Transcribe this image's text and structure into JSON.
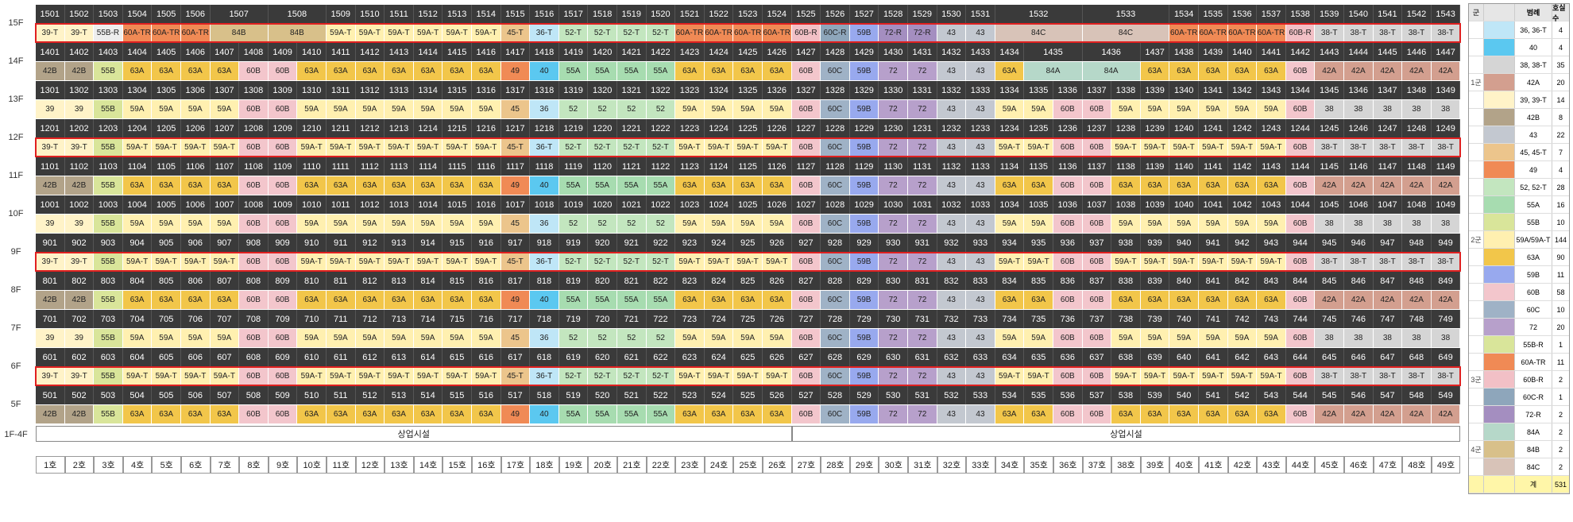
{
  "floors": [
    "15F",
    "14F",
    "13F",
    "12F",
    "11F",
    "10F",
    "9F",
    "8F",
    "7F",
    "6F",
    "5F",
    "1F-4F"
  ],
  "commercial_label": "상업시설",
  "col_labels": [
    "1호",
    "2호",
    "3호",
    "4호",
    "5호",
    "6호",
    "7호",
    "8호",
    "9호",
    "10호",
    "11호",
    "12호",
    "13호",
    "14호",
    "15호",
    "16호",
    "17호",
    "18호",
    "19호",
    "20호",
    "21호",
    "22호",
    "23호",
    "24호",
    "25호",
    "26호",
    "27호",
    "28호",
    "29호",
    "30호",
    "31호",
    "32호",
    "33호",
    "34호",
    "35호",
    "36호",
    "37호",
    "38호",
    "39호",
    "40호",
    "41호",
    "42호",
    "43호",
    "44호",
    "45호",
    "46호",
    "47호",
    "48호",
    "49호"
  ],
  "colors": {
    "39": "#fff3c8",
    "39-T": "#fff3c8",
    "42B": "#b2a389",
    "55B": "#d9e59a",
    "63A": "#f2c64a",
    "59A": "#fff0b0",
    "59A-T": "#fff0b0",
    "60B": "#f3c6cc",
    "45": "#ecc58c",
    "45-T": "#ecc58c",
    "49": "#f08a55",
    "40": "#5bc8f0",
    "36-T": "#bfe6f7",
    "36": "#bfe6f7",
    "52": "#c3e6bf",
    "52-T": "#c3e6bf",
    "55A": "#a7dcb0",
    "60C": "#9fb2c6",
    "59B": "#98a9ee",
    "72": "#b7a0cb",
    "43": "#c3c8d0",
    "38": "#d5d5d5",
    "38-T": "#d5d5d5",
    "42A": "#d39f8f",
    "60A-TR": "#f08a55",
    "84B": "#d8c08a",
    "84C": "#d8c3b8",
    "84A": "#b6d8c9",
    "60B-R": "#f2c0c6",
    "60C-R": "#8ea6bb",
    "72-R": "#a48ec0"
  },
  "rows": [
    {
      "floor": "15F",
      "nums": [
        [
          "1501",
          1
        ],
        [
          "1502",
          1
        ],
        [
          "1503",
          1
        ],
        [
          "1504",
          1
        ],
        [
          "1505",
          1
        ],
        [
          "1506",
          1
        ],
        [
          "1507",
          2
        ],
        [
          "1508",
          2
        ],
        [
          "1509",
          1
        ],
        [
          "1510",
          1
        ],
        [
          "1511",
          1
        ],
        [
          "1512",
          1
        ],
        [
          "1513",
          1
        ],
        [
          "1514",
          1
        ],
        [
          "1515",
          1
        ],
        [
          "1516",
          1
        ],
        [
          "1517",
          1
        ],
        [
          "1518",
          1
        ],
        [
          "1519",
          1
        ],
        [
          "1520",
          1
        ],
        [
          "1521",
          1
        ],
        [
          "1522",
          1
        ],
        [
          "1523",
          1
        ],
        [
          "1524",
          1
        ],
        [
          "1525",
          1
        ],
        [
          "1526",
          1
        ],
        [
          "1527",
          1
        ],
        [
          "1528",
          1
        ],
        [
          "1529",
          1
        ],
        [
          "1530",
          1
        ],
        [
          "1531",
          1
        ],
        [
          "1532",
          3
        ],
        [
          "1533",
          3
        ],
        [
          "1534",
          1
        ],
        [
          "1535",
          1
        ],
        [
          "1536",
          1
        ],
        [
          "1537",
          1
        ],
        [
          "1538",
          1
        ],
        [
          "1539",
          1
        ],
        [
          "1540",
          1
        ],
        [
          "1541",
          1
        ],
        [
          "1542",
          1
        ],
        [
          "1543",
          1
        ]
      ],
      "types": [
        [
          "39-T",
          1
        ],
        [
          "39-T",
          1
        ],
        [
          "55B-R",
          1
        ],
        [
          "60A-TR",
          1
        ],
        [
          "60A-TR",
          1
        ],
        [
          "60A-TR",
          1
        ],
        [
          "84B",
          2
        ],
        [
          "84B",
          2
        ],
        [
          "59A-T",
          1
        ],
        [
          "59A-T",
          1
        ],
        [
          "59A-T",
          1
        ],
        [
          "59A-T",
          1
        ],
        [
          "59A-T",
          1
        ],
        [
          "59A-T",
          1
        ],
        [
          "45-T",
          1
        ],
        [
          "36-T",
          1
        ],
        [
          "52-T",
          1
        ],
        [
          "52-T",
          1
        ],
        [
          "52-T",
          1
        ],
        [
          "52-T",
          1
        ],
        [
          "60A-TR",
          1
        ],
        [
          "60A-TR",
          1
        ],
        [
          "60A-TR",
          1
        ],
        [
          "60A-TR",
          1
        ],
        [
          "60B-R",
          1
        ],
        [
          "60C-R",
          1
        ],
        [
          "59B",
          1
        ],
        [
          "72-R",
          1
        ],
        [
          "72-R",
          1
        ],
        [
          "43",
          1
        ],
        [
          "43",
          1
        ],
        [
          "84C",
          3
        ],
        [
          "84C",
          3
        ],
        [
          "60A-TR",
          1
        ],
        [
          "60A-TR",
          1
        ],
        [
          "60A-TR",
          1
        ],
        [
          "60A-TR",
          1
        ],
        [
          "60B-R",
          1
        ],
        [
          "38-T",
          1
        ],
        [
          "38-T",
          1
        ],
        [
          "38-T",
          1
        ],
        [
          "38-T",
          1
        ],
        [
          "38-T",
          1
        ]
      ],
      "hl": true
    },
    {
      "floor": "14F",
      "nums": [
        [
          "1401",
          1
        ],
        [
          "1402",
          1
        ],
        [
          "1403",
          1
        ],
        [
          "1404",
          1
        ],
        [
          "1405",
          1
        ],
        [
          "1406",
          1
        ],
        [
          "1407",
          1
        ],
        [
          "1408",
          1
        ],
        [
          "1409",
          1
        ],
        [
          "1410",
          1
        ],
        [
          "1411",
          1
        ],
        [
          "1412",
          1
        ],
        [
          "1413",
          1
        ],
        [
          "1414",
          1
        ],
        [
          "1415",
          1
        ],
        [
          "1416",
          1
        ],
        [
          "1417",
          1
        ],
        [
          "1418",
          1
        ],
        [
          "1419",
          1
        ],
        [
          "1420",
          1
        ],
        [
          "1421",
          1
        ],
        [
          "1422",
          1
        ],
        [
          "1423",
          1
        ],
        [
          "1424",
          1
        ],
        [
          "1425",
          1
        ],
        [
          "1426",
          1
        ],
        [
          "1427",
          1
        ],
        [
          "1428",
          1
        ],
        [
          "1429",
          1
        ],
        [
          "1430",
          1
        ],
        [
          "1431",
          1
        ],
        [
          "1432",
          1
        ],
        [
          "1433",
          1
        ],
        [
          "1434",
          1
        ],
        [
          "1435",
          2
        ],
        [
          "1436",
          2
        ],
        [
          "1437",
          1
        ],
        [
          "1438",
          1
        ],
        [
          "1439",
          1
        ],
        [
          "1440",
          1
        ],
        [
          "1441",
          1
        ],
        [
          "1442",
          1
        ],
        [
          "1443",
          1
        ],
        [
          "1444",
          1
        ],
        [
          "1445",
          1
        ],
        [
          "1446",
          1
        ],
        [
          "1447",
          1
        ]
      ],
      "types": [
        [
          "42B",
          1
        ],
        [
          "42B",
          1
        ],
        [
          "55B",
          1
        ],
        [
          "63A",
          1
        ],
        [
          "63A",
          1
        ],
        [
          "63A",
          1
        ],
        [
          "63A",
          1
        ],
        [
          "60B",
          1
        ],
        [
          "60B",
          1
        ],
        [
          "63A",
          1
        ],
        [
          "63A",
          1
        ],
        [
          "63A",
          1
        ],
        [
          "63A",
          1
        ],
        [
          "63A",
          1
        ],
        [
          "63A",
          1
        ],
        [
          "63A",
          1
        ],
        [
          "49",
          1
        ],
        [
          "40",
          1
        ],
        [
          "55A",
          1
        ],
        [
          "55A",
          1
        ],
        [
          "55A",
          1
        ],
        [
          "55A",
          1
        ],
        [
          "63A",
          1
        ],
        [
          "63A",
          1
        ],
        [
          "63A",
          1
        ],
        [
          "63A",
          1
        ],
        [
          "60B",
          1
        ],
        [
          "60C",
          1
        ],
        [
          "59B",
          1
        ],
        [
          "72",
          1
        ],
        [
          "72",
          1
        ],
        [
          "43",
          1
        ],
        [
          "43",
          1
        ],
        [
          "63A",
          1
        ],
        [
          "84A",
          2
        ],
        [
          "84A",
          2
        ],
        [
          "63A",
          1
        ],
        [
          "63A",
          1
        ],
        [
          "63A",
          1
        ],
        [
          "63A",
          1
        ],
        [
          "63A",
          1
        ],
        [
          "60B",
          1
        ],
        [
          "42A",
          1
        ],
        [
          "42A",
          1
        ],
        [
          "42A",
          1
        ],
        [
          "42A",
          1
        ],
        [
          "42A",
          1
        ]
      ],
      "hl": false
    }
  ],
  "std_nums": [
    "01",
    "02",
    "03",
    "04",
    "05",
    "06",
    "07",
    "08",
    "09",
    "10",
    "11",
    "12",
    "13",
    "14",
    "15",
    "16",
    "17",
    "18",
    "19",
    "20",
    "21",
    "22",
    "23",
    "24",
    "25",
    "26",
    "27",
    "28",
    "29",
    "30",
    "31",
    "32",
    "33",
    "34",
    "35",
    "36",
    "37",
    "38",
    "39",
    "40",
    "41",
    "42",
    "43",
    "44",
    "45",
    "46",
    "47",
    "48",
    "49"
  ],
  "std_floors": [
    {
      "floor": "13F",
      "prefix": "13",
      "variant": "A"
    },
    {
      "floor": "12F",
      "prefix": "12",
      "variant": "T"
    },
    {
      "floor": "11F",
      "prefix": "11",
      "variant": "B"
    },
    {
      "floor": "10F",
      "prefix": "10",
      "variant": "A"
    },
    {
      "floor": "9F",
      "prefix": "9",
      "variant": "T"
    },
    {
      "floor": "8F",
      "prefix": "8",
      "variant": "B"
    },
    {
      "floor": "7F",
      "prefix": "7",
      "variant": "A"
    },
    {
      "floor": "6F",
      "prefix": "6",
      "variant": "T"
    },
    {
      "floor": "5F",
      "prefix": "5",
      "variant": "B"
    }
  ],
  "variants": {
    "A": [
      "39",
      "39",
      "55B",
      "59A",
      "59A",
      "59A",
      "59A",
      "60B",
      "60B",
      "59A",
      "59A",
      "59A",
      "59A",
      "59A",
      "59A",
      "59A",
      "45",
      "36",
      "52",
      "52",
      "52",
      "52",
      "59A",
      "59A",
      "59A",
      "59A",
      "60B",
      "60C",
      "59B",
      "72",
      "72",
      "43",
      "43",
      "59A",
      "59A",
      "60B",
      "60B",
      "59A",
      "59A",
      "59A",
      "59A",
      "59A",
      "59A",
      "60B",
      "38",
      "38",
      "38",
      "38",
      "38"
    ],
    "T": [
      "39-T",
      "39-T",
      "55B",
      "59A-T",
      "59A-T",
      "59A-T",
      "59A-T",
      "60B",
      "60B",
      "59A-T",
      "59A-T",
      "59A-T",
      "59A-T",
      "59A-T",
      "59A-T",
      "59A-T",
      "45-T",
      "36-T",
      "52-T",
      "52-T",
      "52-T",
      "52-T",
      "59A-T",
      "59A-T",
      "59A-T",
      "59A-T",
      "60B",
      "60C",
      "59B",
      "72",
      "72",
      "43",
      "43",
      "59A-T",
      "59A-T",
      "60B",
      "60B",
      "59A-T",
      "59A-T",
      "59A-T",
      "59A-T",
      "59A-T",
      "59A-T",
      "60B",
      "38-T",
      "38-T",
      "38-T",
      "38-T",
      "38-T"
    ],
    "B": [
      "42B",
      "42B",
      "55B",
      "63A",
      "63A",
      "63A",
      "63A",
      "60B",
      "60B",
      "63A",
      "63A",
      "63A",
      "63A",
      "63A",
      "63A",
      "63A",
      "49",
      "40",
      "55A",
      "55A",
      "55A",
      "55A",
      "63A",
      "63A",
      "63A",
      "63A",
      "60B",
      "60C",
      "59B",
      "72",
      "72",
      "43",
      "43",
      "63A",
      "63A",
      "60B",
      "60B",
      "63A",
      "63A",
      "63A",
      "63A",
      "63A",
      "63A",
      "60B",
      "42A",
      "42A",
      "42A",
      "42A",
      "42A"
    ]
  },
  "legend": {
    "headers": [
      "군",
      "범례",
      "호실 수"
    ],
    "groups": [
      {
        "name": "1군",
        "items": [
          [
            "36, 36-T",
            "4",
            "#bfe6f7"
          ],
          [
            "40",
            "4",
            "#5bc8f0"
          ],
          [
            "38, 38-T",
            "35",
            "#d5d5d5"
          ],
          [
            "42A",
            "20",
            "#d39f8f"
          ],
          [
            "39, 39-T",
            "14",
            "#fff3c8"
          ],
          [
            "42B",
            "8",
            "#b2a389"
          ],
          [
            "43",
            "22",
            "#c3c8d0"
          ]
        ]
      },
      {
        "name": "2군",
        "items": [
          [
            "45, 45-T",
            "7",
            "#ecc58c"
          ],
          [
            "49",
            "4",
            "#f08a55"
          ],
          [
            "52, 52-T",
            "28",
            "#c3e6bf"
          ],
          [
            "55A",
            "16",
            "#a7dcb0"
          ],
          [
            "55B",
            "10",
            "#d9e59a"
          ],
          [
            "59A/59A-T",
            "144",
            "#fff0b0"
          ],
          [
            "63A",
            "90",
            "#f2c64a"
          ],
          [
            "59B",
            "11",
            "#98a9ee"
          ],
          [
            "60B",
            "58",
            "#f3c6cc"
          ],
          [
            "60C",
            "10",
            "#9fb2c6"
          ],
          [
            "72",
            "20",
            "#b7a0cb"
          ]
        ]
      },
      {
        "name": "3군",
        "items": [
          [
            "55B-R",
            "1",
            "#d9e59a"
          ],
          [
            "60A-TR",
            "11",
            "#f08a55"
          ],
          [
            "60B-R",
            "2",
            "#f2c0c6"
          ],
          [
            "60C-R",
            "1",
            "#8ea6bb"
          ],
          [
            "72-R",
            "2",
            "#a48ec0"
          ]
        ]
      },
      {
        "name": "4군",
        "items": [
          [
            "84A",
            "2",
            "#b6d8c9"
          ],
          [
            "84B",
            "2",
            "#d8c08a"
          ],
          [
            "84C",
            "2",
            "#d8c3b8"
          ]
        ]
      }
    ],
    "total_label": "계",
    "total_value": "531"
  }
}
